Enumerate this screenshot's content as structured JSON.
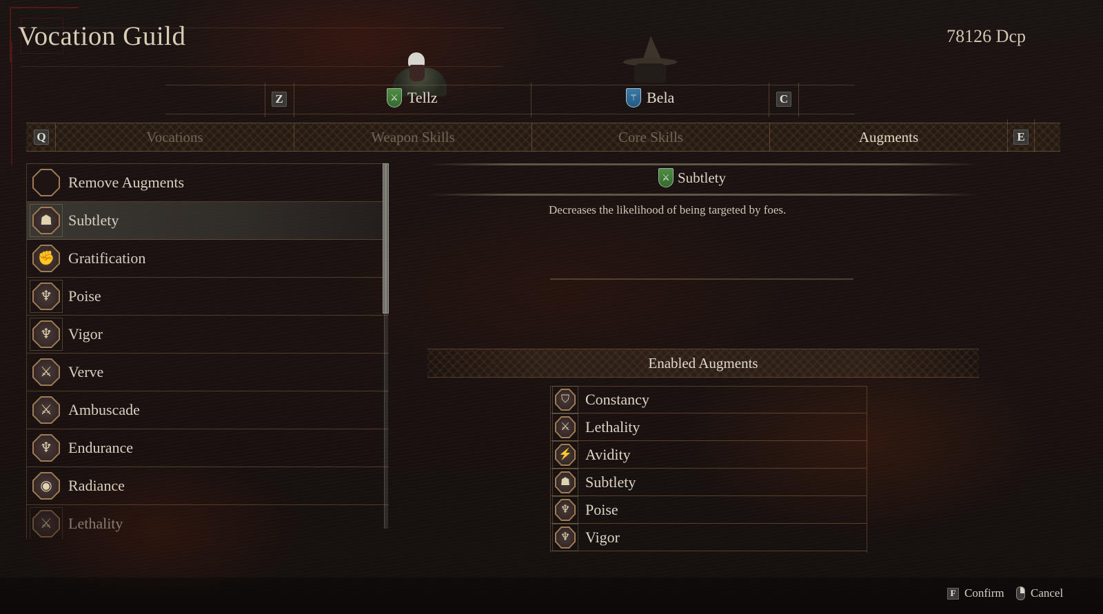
{
  "header": {
    "title": "Vocation Guild",
    "currency": "78126 Dcp"
  },
  "characters": {
    "prev_key": "Z",
    "next_key": "C",
    "items": [
      {
        "name": "Tellz",
        "vocation_icon": "crossed-daggers-shield-icon",
        "emblem_color": "#4e8c44",
        "selected": true
      },
      {
        "name": "Bela",
        "vocation_icon": "staff-shield-icon",
        "emblem_color": "#3a7aa8",
        "selected": false
      }
    ]
  },
  "tabs": {
    "prev_key": "Q",
    "next_key": "E",
    "items": [
      {
        "label": "Vocations",
        "active": false
      },
      {
        "label": "Weapon Skills",
        "active": false
      },
      {
        "label": "Core Skills",
        "active": false
      },
      {
        "label": "Augments",
        "active": true
      }
    ]
  },
  "augment_list": {
    "items": [
      {
        "label": "Remove Augments",
        "icon": "empty-octagon-icon",
        "glyph": "",
        "selected": false
      },
      {
        "label": "Subtlety",
        "icon": "hooded-figure-icon",
        "glyph": "☗",
        "selected": true
      },
      {
        "label": "Gratification",
        "icon": "raised-fist-icon",
        "glyph": "✊",
        "selected": false
      },
      {
        "label": "Poise",
        "icon": "flexing-body-icon",
        "glyph": "♆",
        "selected": false
      },
      {
        "label": "Vigor",
        "icon": "flexing-body-icon",
        "glyph": "♆",
        "selected": false
      },
      {
        "label": "Verve",
        "icon": "crossed-swords-icon",
        "glyph": "⚔",
        "selected": false
      },
      {
        "label": "Ambuscade",
        "icon": "crossed-swords-icon",
        "glyph": "⚔",
        "selected": false
      },
      {
        "label": "Endurance",
        "icon": "flexing-body-icon",
        "glyph": "♆",
        "selected": false
      },
      {
        "label": "Radiance",
        "icon": "eye-icon",
        "glyph": "◉",
        "selected": false
      },
      {
        "label": "Lethality",
        "icon": "crossed-swords-icon",
        "glyph": "⚔",
        "selected": false
      }
    ]
  },
  "detail": {
    "title": "Subtlety",
    "vocation_icon": "crossed-daggers-shield-icon",
    "description": "Decreases the likelihood of being targeted by foes."
  },
  "enabled_augments": {
    "heading": "Enabled Augments",
    "items": [
      {
        "label": "Constancy",
        "icon": "shield-icon",
        "glyph": "⛉"
      },
      {
        "label": "Lethality",
        "icon": "crossed-swords-icon",
        "glyph": "⚔"
      },
      {
        "label": "Avidity",
        "icon": "running-figure-icon",
        "glyph": "⚡"
      },
      {
        "label": "Subtlety",
        "icon": "hooded-figure-icon",
        "glyph": "☗"
      },
      {
        "label": "Poise",
        "icon": "flexing-body-icon",
        "glyph": "♆"
      },
      {
        "label": "Vigor",
        "icon": "flexing-body-icon",
        "glyph": "♆"
      }
    ]
  },
  "footer": {
    "confirm_key": "F",
    "confirm_label": "Confirm",
    "cancel_label": "Cancel"
  }
}
